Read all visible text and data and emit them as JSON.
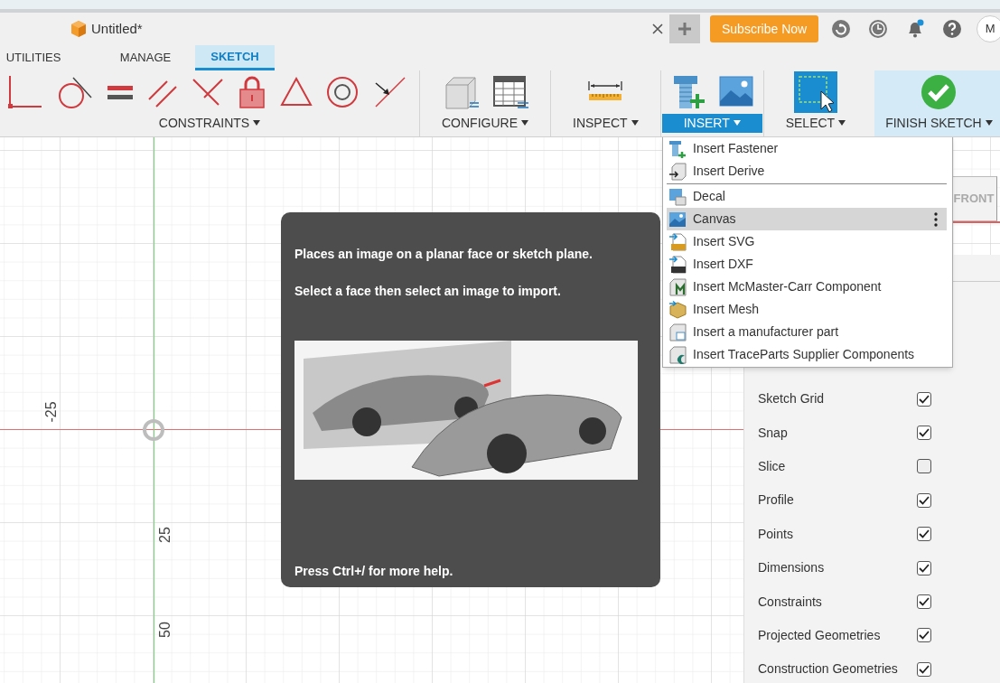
{
  "document_tab": {
    "title": "Untitled*"
  },
  "header": {
    "subscribe": "Subscribe Now",
    "avatar": "M"
  },
  "ribbon_tabs": [
    {
      "label": "UTILITIES",
      "selected": false
    },
    {
      "label": "MANAGE",
      "selected": false
    },
    {
      "label": "SKETCH",
      "selected": true
    }
  ],
  "toolbar_groups": [
    {
      "kind": "constraints",
      "label": "CONSTRAINTS",
      "selected": false,
      "highlighted": false
    },
    {
      "kind": "configure",
      "label": "CONFIGURE",
      "selected": false,
      "highlighted": false
    },
    {
      "kind": "inspect",
      "label": "INSPECT",
      "selected": false,
      "highlighted": false
    },
    {
      "kind": "insert",
      "label": "INSERT",
      "selected": true,
      "highlighted": false
    },
    {
      "kind": "select",
      "label": "SELECT",
      "selected": false,
      "highlighted": false
    },
    {
      "kind": "finish",
      "label": "FINISH SKETCH",
      "selected": false,
      "highlighted": true
    }
  ],
  "insert_menu": {
    "sections": [
      [
        {
          "label": "Insert Fastener",
          "selected": false
        },
        {
          "label": "Insert Derive",
          "selected": false
        }
      ],
      [
        {
          "label": "Decal",
          "selected": false
        },
        {
          "label": "Canvas",
          "selected": true
        },
        {
          "label": "Insert SVG",
          "selected": false
        },
        {
          "label": "Insert DXF",
          "selected": false
        },
        {
          "label": "Insert McMaster-Carr Component",
          "selected": false
        },
        {
          "label": "Insert Mesh",
          "selected": false
        },
        {
          "label": "Insert a manufacturer part",
          "selected": false
        },
        {
          "label": "Insert TraceParts Supplier Components",
          "selected": false
        }
      ]
    ]
  },
  "tooltip": {
    "description": "Places an image on a planar face or sketch plane.",
    "instruction": "Select a face then select an image to import.",
    "footer": "Press Ctrl+/ for more help."
  },
  "canvas": {
    "axis_labels": [
      "-25",
      "25",
      "50"
    ],
    "view_cube": "FRONT"
  },
  "sketch_palette": {
    "rows": [
      {
        "label": "Sketch Grid",
        "checked": true
      },
      {
        "label": "Snap",
        "checked": true
      },
      {
        "label": "Slice",
        "checked": false
      },
      {
        "label": "Profile",
        "checked": true
      },
      {
        "label": "Points",
        "checked": true
      },
      {
        "label": "Dimensions",
        "checked": true
      },
      {
        "label": "Constraints",
        "checked": true
      },
      {
        "label": "Projected Geometries",
        "checked": true
      },
      {
        "label": "Construction Geometries",
        "checked": true
      }
    ]
  }
}
